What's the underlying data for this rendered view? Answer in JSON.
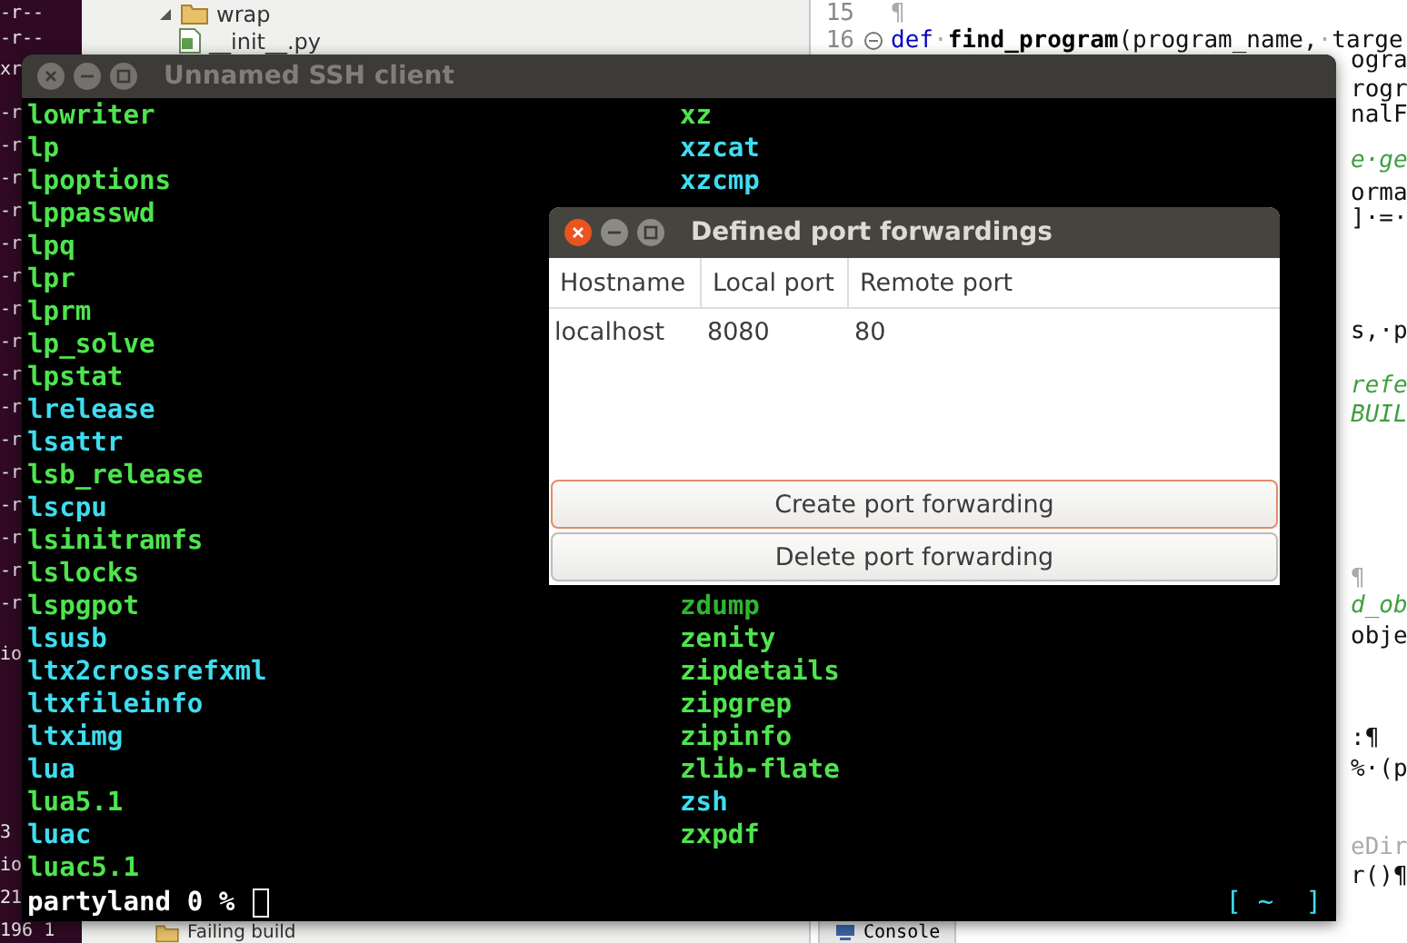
{
  "desktop": {
    "side_terminal": {
      "lines": [
        "-r--",
        "-r--",
        "xr",
        "-r",
        "-r",
        "-r",
        "-r",
        "-r",
        "-r",
        "-r",
        "-r",
        "-r",
        "-r",
        "-r",
        "-r",
        "-r",
        "-r",
        "-r",
        "-r",
        "io",
        "3",
        "io",
        "21",
        "196 1"
      ]
    },
    "project_tree": {
      "items": [
        {
          "label": "wrap",
          "kind": "folder"
        },
        {
          "label": "__init__.py",
          "kind": "python-file"
        }
      ],
      "bottom_item": {
        "label": "Failing build"
      }
    },
    "editor": {
      "lines": [
        {
          "number": "15",
          "fold": false,
          "tokens": [
            {
              "text": "¶",
              "kind": "whitespace"
            }
          ]
        },
        {
          "number": "16",
          "fold": true,
          "tokens": [
            {
              "text": "def",
              "kind": "keyword"
            },
            {
              "text": "·",
              "kind": "whitespace"
            },
            {
              "text": "find_program",
              "kind": "name"
            },
            {
              "text": "(program_name,",
              "kind": "code"
            },
            {
              "text": "·",
              "kind": "whitespace"
            },
            {
              "text": "targe",
              "kind": "code"
            }
          ]
        }
      ],
      "fragments": [
        {
          "text": "ogra",
          "kind": "code"
        },
        {
          "text": "rogr",
          "kind": "code"
        },
        {
          "text": "nalF",
          "kind": "code"
        },
        {
          "text": "e·ge",
          "kind": "comment"
        },
        {
          "text": "orma",
          "kind": "code"
        },
        {
          "text": "]·=·",
          "kind": "code"
        },
        {
          "text": "s,·p",
          "kind": "code"
        },
        {
          "text": "refe",
          "kind": "comment"
        },
        {
          "text": "BUIL",
          "kind": "comment"
        },
        {
          "text": "¶",
          "kind": "whitespace"
        },
        {
          "text": "d_ob",
          "kind": "comment"
        },
        {
          "text": "obje",
          "kind": "code"
        },
        {
          "text": ":¶",
          "kind": "code"
        },
        {
          "text": "%·(p",
          "kind": "code"
        },
        {
          "text": "eDir",
          "kind": "whitespace"
        },
        {
          "text": "r()¶",
          "kind": "code"
        }
      ]
    },
    "console_tab": {
      "label": "Console"
    }
  },
  "terminal_window": {
    "title": "Unnamed SSH client",
    "active": false,
    "column_1": [
      {
        "text": "lowriter",
        "color": "#4ee44e"
      },
      {
        "text": "lp",
        "color": "#4ee44e"
      },
      {
        "text": "lpoptions",
        "color": "#4ee44e"
      },
      {
        "text": "lppasswd",
        "color": "#4ee44e"
      },
      {
        "text": "lpq",
        "color": "#4ee44e"
      },
      {
        "text": "lpr",
        "color": "#4ee44e"
      },
      {
        "text": "lprm",
        "color": "#4ee44e"
      },
      {
        "text": "lp_solve",
        "color": "#4ee44e"
      },
      {
        "text": "lpstat",
        "color": "#4ee44e"
      },
      {
        "text": "lrelease",
        "color": "#3fdcef"
      },
      {
        "text": "lsattr",
        "color": "#3fdcef"
      },
      {
        "text": "lsb_release",
        "color": "#4ee44e"
      },
      {
        "text": "lscpu",
        "color": "#3fdcef"
      },
      {
        "text": "lsinitramfs",
        "color": "#4ee44e"
      },
      {
        "text": "lslocks",
        "color": "#4ee44e"
      },
      {
        "text": "lspgpot",
        "color": "#4ee44e"
      },
      {
        "text": "lsusb",
        "color": "#3fdcef"
      },
      {
        "text": "ltx2crossrefxml",
        "color": "#3fdcef"
      },
      {
        "text": "ltxfileinfo",
        "color": "#3fdcef"
      },
      {
        "text": "ltximg",
        "color": "#3fdcef"
      },
      {
        "text": "lua",
        "color": "#3fdcef"
      },
      {
        "text": "lua5.1",
        "color": "#4ee44e"
      },
      {
        "text": "luac",
        "color": "#3fdcef"
      },
      {
        "text": "luac5.1",
        "color": "#4ee44e"
      }
    ],
    "column_2_top": [
      {
        "text": "xz",
        "color": "#4ee44e"
      },
      {
        "text": "xzcat",
        "color": "#3fdcef"
      },
      {
        "text": "xzcmp",
        "color": "#3fdcef"
      }
    ],
    "column_2_bottom": [
      {
        "text": "zdump",
        "color": "#2fb52f"
      },
      {
        "text": "zenity",
        "color": "#4ee44e"
      },
      {
        "text": "zipdetails",
        "color": "#4ee44e"
      },
      {
        "text": "zipgrep",
        "color": "#4ee44e"
      },
      {
        "text": "zipinfo",
        "color": "#4ee44e"
      },
      {
        "text": "zlib-flate",
        "color": "#4ee44e"
      },
      {
        "text": "zsh",
        "color": "#3fdcef"
      },
      {
        "text": "zxpdf",
        "color": "#4ee44e"
      }
    ],
    "prompt": "partyland 0 %",
    "status": "[ ~  ]"
  },
  "dialog": {
    "title": "Defined port forwardings",
    "active": true,
    "table": {
      "columns": [
        "Hostname",
        "Local port",
        "Remote port"
      ],
      "rows": [
        [
          "localhost",
          "8080",
          "80"
        ]
      ]
    },
    "buttons": [
      {
        "label": "Create port forwarding",
        "focused": true
      },
      {
        "label": "Delete port forwarding",
        "focused": false
      }
    ]
  }
}
